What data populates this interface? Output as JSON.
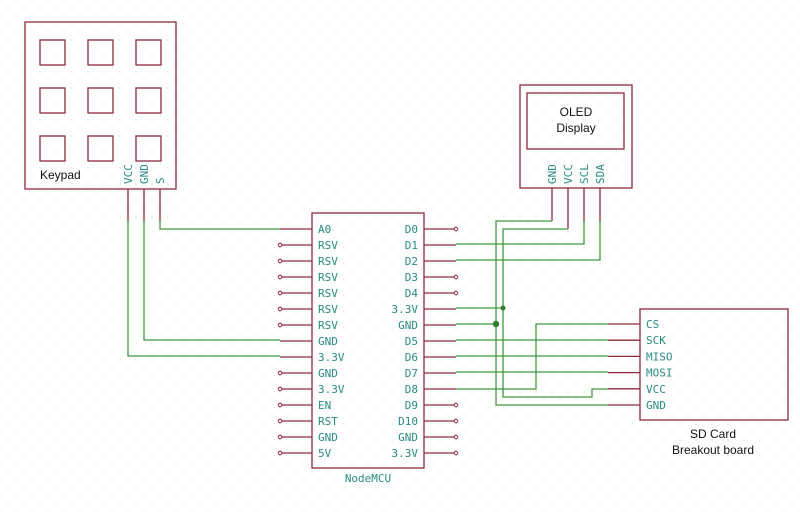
{
  "keypad": {
    "label": "Keypad",
    "pins": [
      "VCC",
      "GND",
      "S"
    ]
  },
  "oled": {
    "label_line1": "OLED",
    "label_line2": "Display",
    "pins": [
      "GND",
      "VCC",
      "SCL",
      "SDA"
    ]
  },
  "nodemcu": {
    "label": "NodeMCU",
    "left_pins": [
      "A0",
      "RSV",
      "RSV",
      "RSV",
      "RSV",
      "RSV",
      "RSV",
      "GND",
      "3.3V",
      "GND",
      "3.3V",
      "EN",
      "RST",
      "GND",
      "5V"
    ],
    "right_pins": [
      "D0",
      "D1",
      "D2",
      "D3",
      "D4",
      "3.3V",
      "GND",
      "D5",
      "D6",
      "D7",
      "D8",
      "D9",
      "D10",
      "GND",
      "3.3V"
    ]
  },
  "sdcard": {
    "label_line1": "SD Card",
    "label_line2": "Breakout board",
    "pins": [
      "CS",
      "SCK",
      "MISO",
      "MOSI",
      "VCC",
      "GND"
    ]
  },
  "colors": {
    "wire": "#3f9a3f",
    "component": "#8c2a3c",
    "pin_text": "#2a8a84"
  }
}
